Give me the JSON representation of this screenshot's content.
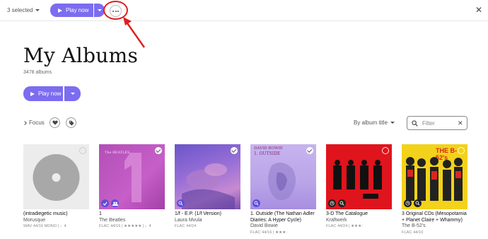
{
  "topbar": {
    "selected_label": "3 selected",
    "play_label": "Play now",
    "more_icon": "ellipsis-icon",
    "close_glyph": "✕"
  },
  "header": {
    "title": "My Albums",
    "count": "3478 albums",
    "play_label": "Play now"
  },
  "filters": {
    "focus_label": "Focus",
    "sort_label": "By album title",
    "filter_placeholder": "Filter"
  },
  "colors": {
    "accent": "#7c6cf0",
    "annotation": "#e01e1e"
  },
  "albums": [
    {
      "title": "(intradiegetic music)",
      "artist": "Morusque",
      "meta": "WAV 44/16 MONO | ♩4",
      "selected": false
    },
    {
      "title": "1",
      "artist": "The Beatles",
      "meta": "FLAC 44/16 | ★★★★★ | ♩4",
      "selected": true
    },
    {
      "title": "1/f - E.P. (1/f Version)",
      "artist": "Laura Mvula",
      "meta": "FLAC 44/24",
      "selected": true
    },
    {
      "title": "1. Outside (The Nathan Adler Diaries: A Hyper Cycle)",
      "artist": "David Bowie",
      "meta": "FLAC 44/16 | ★★★·",
      "selected": true
    },
    {
      "title": "3-D The Catalogue",
      "artist": "Kraftwerk",
      "meta": "FLAC 44/24 | ★★★·",
      "selected": false
    },
    {
      "title": "3 Original CDs (Mesopotamia + Planet Claire + Whammy)",
      "artist": "The B-52's",
      "meta": "FLAC 44/16",
      "selected": false
    }
  ],
  "cover_text": {
    "beatles": "The BEATLES",
    "bowie_top": "DAVID BOWIE",
    "bowie_sub": "1. OUTSIDE",
    "b52": "THE B-52's"
  }
}
